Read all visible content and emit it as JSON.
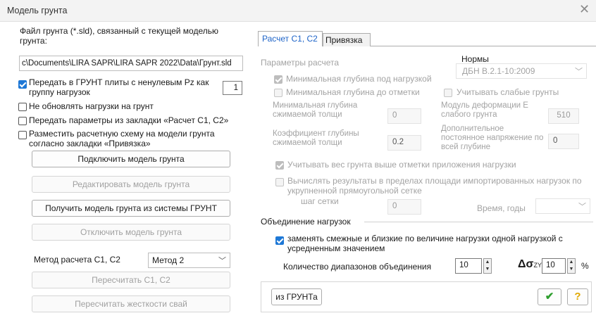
{
  "window": {
    "title": "Модель грунта"
  },
  "left": {
    "file_label": "Файл грунта (*.sld), связанный с текущей моделью грунта:",
    "file_path": "c\\Documents\\LIRA SAPR\\LIRA SAPR 2022\\Data\\Грунт.sld",
    "cb_transfer_plates": "Передать в ГРУНТ плиты с ненулевым Pz как группу нагрузок",
    "group_value": "1",
    "cb_no_update": "Не обновлять нагрузки на грунт",
    "cb_transfer_params": "Передать параметры из закладки «Расчет С1, С2»",
    "cb_place_scheme": "Разместить расчетную схему на модели грунта согласно закладки «Привязка»",
    "btn_connect": "Подключить модель грунта",
    "btn_edit": "Редактировать модель грунта",
    "btn_get": "Получить модель грунта из системы ГРУНТ",
    "btn_disconnect": "Отключить модель грунта",
    "method_label": "Метод расчета С1, С2",
    "method_value": "Метод 2",
    "btn_recalc": "Пересчитать С1, С2",
    "btn_recalc_piles": "Пересчитать жесткости свай"
  },
  "tabs": {
    "calc": "Расчет С1, С2",
    "binding": "Привязка"
  },
  "right": {
    "params_label": "Параметры расчета",
    "norms_label": "Нормы",
    "norms_value": "ДБН В.2.1-10:2009",
    "cb_min_depth_load": "Минимальная глубина под нагрузкой",
    "cb_min_depth_mark": "Минимальная глубина до отметки",
    "cb_weak_soils": "Учитывать слабые грунты",
    "min_depth_label": "Минимальная глубина сжимаемой толщи",
    "min_depth_value": "0",
    "deform_label": "Модуль деформации Е слабого грунта",
    "deform_value": "510",
    "coef_label": "Коэффициент глубины сжимаемой толщи",
    "coef_value": "0.2",
    "add_stress_label": "Дополнительное постоянное напряжение по всей глубине",
    "add_stress_value": "0",
    "cb_soil_weight": "Учитывать вес грунта выше отметки приложения нагрузки",
    "cb_grid": "Вычислять результаты в пределах площади импортированных нагрузок по укрупненной прямоугольной сетке",
    "grid_step_label": "шаг сетки",
    "grid_step_value": "0",
    "time_label": "Время, годы",
    "merge_label": "Объединение нагрузок",
    "cb_replace": "заменять смежные и близкие по величине нагрузки одной нагрузкой с усредненным значением",
    "ranges_label": "Количество диапазонов объединения",
    "ranges_value": "10",
    "delta_symbol": "Δσ",
    "delta_sub": "ZY",
    "delta_value": "10",
    "percent": "%",
    "btn_from_grunt": "из ГРУНТа",
    "btn_ok_icon": "✔",
    "btn_help": "?"
  },
  "colors": {
    "accent": "#1e78d6",
    "ok": "#2e9e2e",
    "help": "#e0a800"
  }
}
